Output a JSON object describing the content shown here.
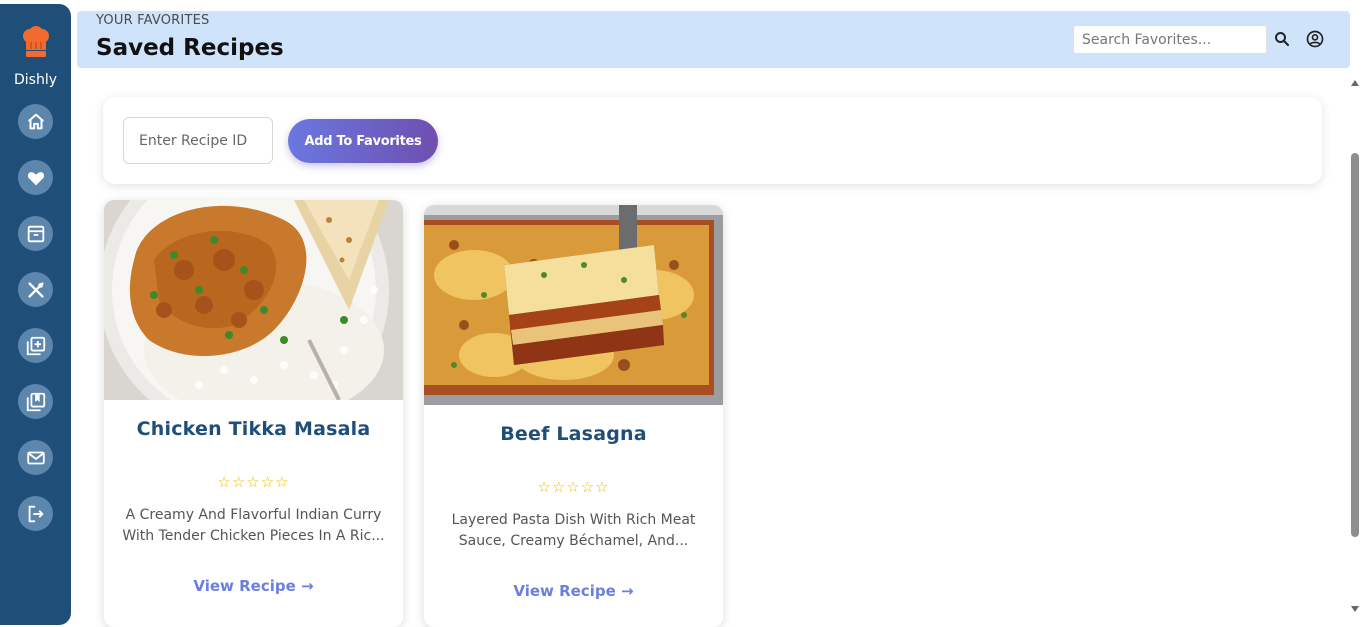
{
  "app": {
    "name": "Dishly"
  },
  "sidebar": {
    "items": [
      {
        "icon": "home-icon"
      },
      {
        "icon": "heart-icon"
      },
      {
        "icon": "archive-icon"
      },
      {
        "icon": "utensils-icon"
      },
      {
        "icon": "add-library-icon"
      },
      {
        "icon": "bookmarks-icon"
      },
      {
        "icon": "mail-icon"
      },
      {
        "icon": "logout-icon"
      }
    ]
  },
  "header": {
    "eyebrow": "YOUR FAVORITES",
    "title": "Saved Recipes",
    "search_placeholder": "Search Favorites..."
  },
  "add_panel": {
    "input_placeholder": "Enter Recipe ID",
    "button_label": "Add To Favorites"
  },
  "cards": [
    {
      "title": "Chicken Tikka Masala",
      "stars": "☆☆☆☆☆",
      "description": "A Creamy And Flavorful Indian Curry With Tender Chicken Pieces In A Ric...",
      "link": "View Recipe →"
    },
    {
      "title": "Beef Lasagna",
      "stars": "☆☆☆☆☆",
      "description": "Layered Pasta Dish With Rich Meat Sauce, Creamy Béchamel, And...",
      "link": "View Recipe →"
    }
  ],
  "colors": {
    "sidebar": "#1f4e79",
    "header": "#cfe4fb",
    "accent": "#6a78e0",
    "title": "#1f4e79",
    "stars": "#e7c000"
  }
}
